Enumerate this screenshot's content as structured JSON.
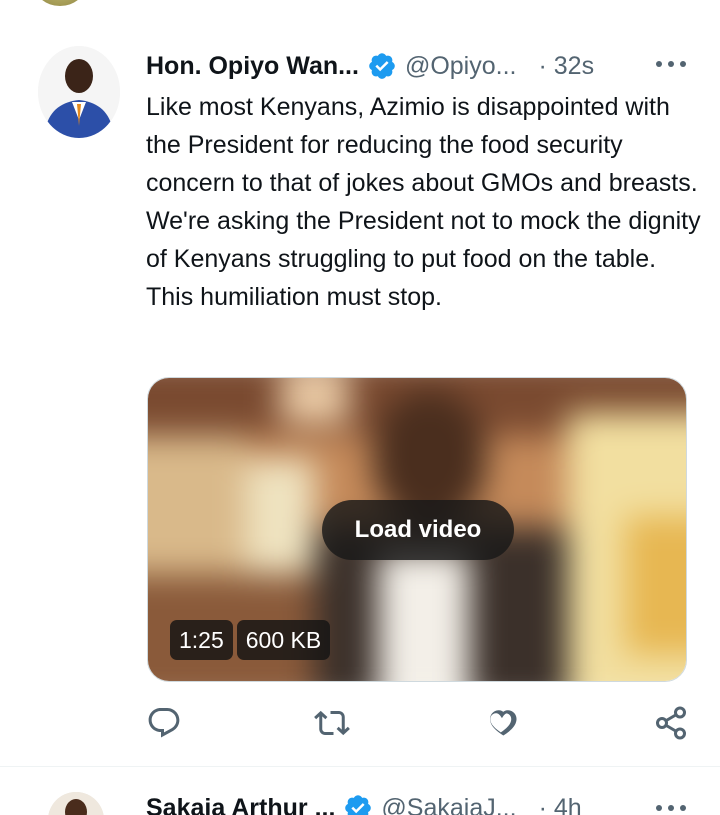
{
  "tweet": {
    "author_name": "Hon. Opiyo Wan...",
    "handle": "@Opiyo...",
    "time": "· 32s",
    "text": "Like most Kenyans, Azimio is disappointed with the President for reducing the food security concern to that of jokes about GMOs and breasts. We're asking the President not to mock the dignity of Kenyans struggling to put food on the table. This humiliation must stop.",
    "media": {
      "load_label": "Load video",
      "duration": "1:25",
      "size": "600 KB"
    },
    "actions": [
      "reply-icon",
      "retweet-icon",
      "like-icon",
      "share-icon"
    ]
  },
  "next_tweet": {
    "author_name": "Sakaja Arthur ...",
    "handle": "@SakajaJ...",
    "time": "· 4h"
  },
  "colors": {
    "verified": "#1d9bf0",
    "secondary_text": "#536471",
    "primary_text": "#0f1419",
    "divider": "#eff3f4"
  }
}
